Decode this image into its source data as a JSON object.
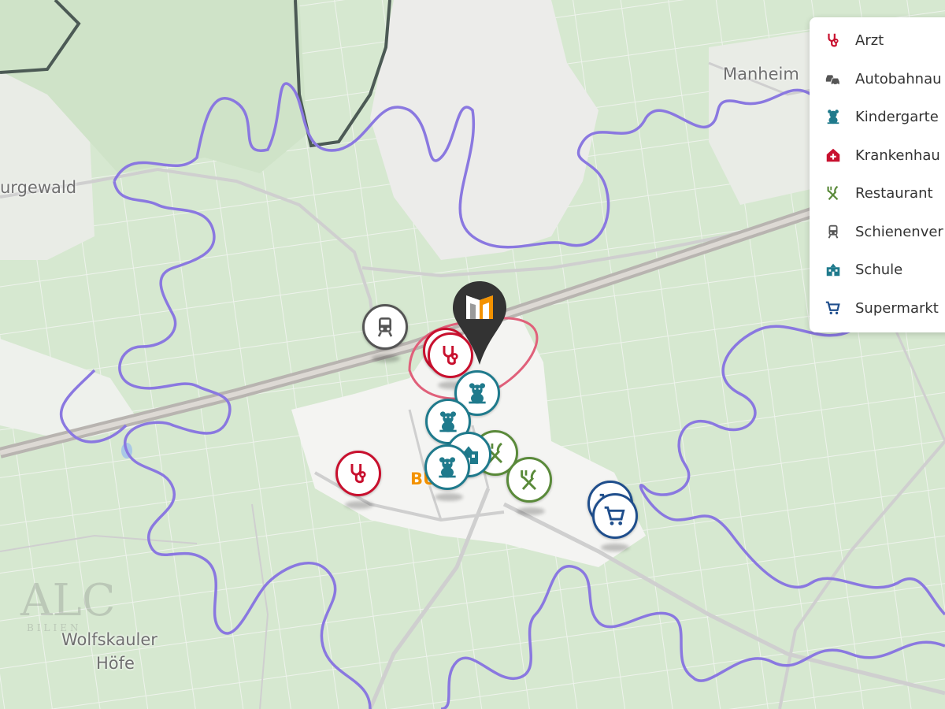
{
  "map": {
    "places": {
      "burgewald": "urgewald",
      "manheim": "Manheim",
      "wolfskauler": "Wolfskauler",
      "hoefe": "Höfe",
      "buir": "BUIR"
    },
    "watermark": {
      "logo": "ALC",
      "sub": "BILIEN"
    },
    "colors": {
      "arzt": "#c8102e",
      "kindergarten": "#1f7a8c",
      "restaurant": "#5a8a3a",
      "schiene": "#555555",
      "supermarkt": "#1f4e8c",
      "krankenhaus": "#c8102e",
      "schule": "#1f7a8c",
      "radius": "#8a78e0",
      "marker": "#333333",
      "marker_accent": "#f39200"
    },
    "pois": [
      {
        "category": "schienenverkehr",
        "icon": "train-icon"
      },
      {
        "category": "arzt",
        "icon": "stethoscope-icon"
      },
      {
        "category": "arzt",
        "icon": "stethoscope-icon"
      },
      {
        "category": "kindergarten",
        "icon": "teddy-bear-icon"
      },
      {
        "category": "kindergarten",
        "icon": "teddy-bear-icon"
      },
      {
        "category": "schule",
        "icon": "school-icon"
      },
      {
        "category": "kindergarten",
        "icon": "teddy-bear-icon"
      },
      {
        "category": "restaurant",
        "icon": "fork-knife-icon"
      },
      {
        "category": "restaurant",
        "icon": "fork-knife-icon"
      },
      {
        "category": "arzt",
        "icon": "stethoscope-icon"
      },
      {
        "category": "supermarkt",
        "icon": "cart-icon"
      },
      {
        "category": "supermarkt",
        "icon": "cart-icon"
      }
    ]
  },
  "legend": {
    "items": [
      {
        "label": "Arzt",
        "icon": "stethoscope-icon",
        "color": "#c8102e"
      },
      {
        "label": "Autobahnau",
        "icon": "cars-icon",
        "color": "#555555"
      },
      {
        "label": "Kindergarte",
        "icon": "teddy-bear-icon",
        "color": "#1f7a8c"
      },
      {
        "label": "Krankenhau",
        "icon": "hospital-icon",
        "color": "#c8102e"
      },
      {
        "label": "Restaurant",
        "icon": "fork-knife-icon",
        "color": "#5a8a3a"
      },
      {
        "label": "Schienenver",
        "icon": "train-icon",
        "color": "#555555"
      },
      {
        "label": "Schule",
        "icon": "school-icon",
        "color": "#1f7a8c"
      },
      {
        "label": "Supermarkt",
        "icon": "cart-icon",
        "color": "#1f4e8c"
      }
    ]
  }
}
